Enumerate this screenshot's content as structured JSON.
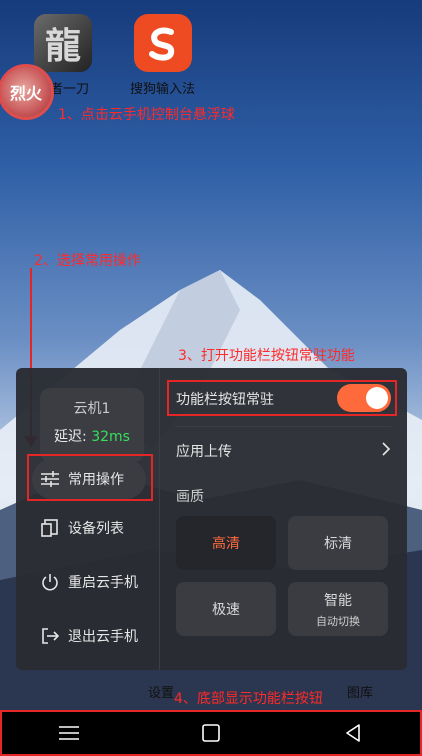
{
  "desktop": {
    "apps": [
      {
        "label": "王者一刀",
        "glyph": "龍"
      },
      {
        "label": "搜狗输入法",
        "glyph": "S"
      }
    ],
    "float_ball_text": "烈火",
    "dock_labels": [
      "设置",
      "图库"
    ]
  },
  "annotations": {
    "step1": "1、点击云手机控制台悬浮球",
    "step2": "2、选择常用操作",
    "step3": "3、打开功能栏按钮常驻功能",
    "step4": "4、底部显示功能栏按钮"
  },
  "panel": {
    "device_name": "云机1",
    "latency_label": "延迟:",
    "latency_value": "32ms",
    "menu": [
      {
        "label": "常用操作",
        "icon": "sliders-icon"
      },
      {
        "label": "设备列表",
        "icon": "device-list-icon"
      },
      {
        "label": "重启云手机",
        "icon": "power-icon"
      },
      {
        "label": "退出云手机",
        "icon": "exit-icon"
      }
    ],
    "toolbar_pin_label": "功能栏按钮常驻",
    "toolbar_pin_on": true,
    "upload_label": "应用上传",
    "quality_label": "画质",
    "quality_options": [
      {
        "label": "高清",
        "selected": true
      },
      {
        "label": "标清",
        "selected": false
      },
      {
        "label": "极速",
        "selected": false
      },
      {
        "label": "智能",
        "sub": "自动切换",
        "selected": false
      }
    ]
  },
  "colors": {
    "accent": "#ff6a3d",
    "latency": "#36e05a",
    "annotation": "#ff2a2a"
  }
}
